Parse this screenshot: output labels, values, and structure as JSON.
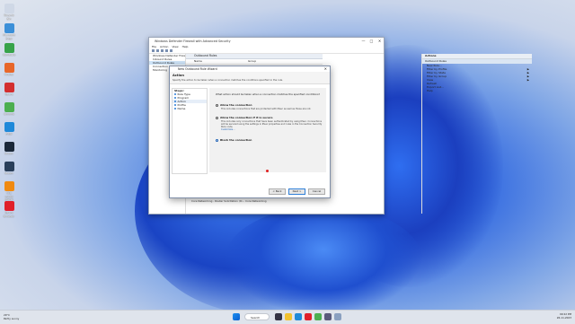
{
  "desktop": {
    "icons": [
      {
        "label": "Recycle Bin",
        "color": "#cfd8e6"
      },
      {
        "label": "Microsoft Edge",
        "color": "#3b8fd8"
      },
      {
        "label": "Camtasia",
        "color": "#37a34a"
      },
      {
        "label": "Firefox",
        "color": "#e8672a"
      },
      {
        "label": "Opera",
        "color": "#d32f2f"
      },
      {
        "label": "Chrome",
        "color": "#4caf50"
      },
      {
        "label": "Edge",
        "color": "#1f89d9"
      },
      {
        "label": "Steam",
        "color": "#1b2838"
      },
      {
        "label": "Steam",
        "color": "#2a3f5a"
      },
      {
        "label": "VLC media player",
        "color": "#f08a12"
      },
      {
        "label": "Opera Browser",
        "color": "#e0202a"
      }
    ]
  },
  "main_window": {
    "title": "Windows Defender Firewall with Advanced Security",
    "controls": {
      "min": "—",
      "max": "□",
      "close": "✕"
    },
    "menu": [
      "File",
      "Action",
      "View",
      "Help"
    ],
    "tree": [
      "Windows Defender Firewall wit",
      "Inbound Rules",
      "Outbound Rules",
      "Connection Security Rules",
      "Monitoring"
    ],
    "center_header": "Outbound Rules",
    "columns": [
      "Name",
      "Group"
    ],
    "actions_header": "Actions",
    "actions_sub": "Outbound Rules",
    "actions_items": [
      "New Rule...",
      "Filter by Profile",
      "Filter by State",
      "Filter by Group",
      "View",
      "Refresh",
      "Export List...",
      "Help"
    ],
    "status_row": "Core Networking - Router Solicitation (IC...   Core Networking"
  },
  "wizard": {
    "title": "New Outbound Rule Wizard",
    "heading": "Action",
    "description": "Specify the action to be taken when a connection matches the conditions specified in the rule.",
    "steps_label": "Steps:",
    "steps": [
      "Rule Type",
      "Program",
      "Action",
      "Profile",
      "Name"
    ],
    "current_step": 2,
    "question": "What action should be taken when a connection matches the specified conditions?",
    "options": [
      {
        "title": "Allow the connection",
        "desc": "This includes connections that are protected with IPsec as well as those are not.",
        "selected": false
      },
      {
        "title": "Allow the connection if it is secure",
        "desc": "This includes only connections that have been authenticated by using IPsec. Connections will be secured using the settings in IPsec properties and rules in the Connection Security Rule node.",
        "selected": false,
        "link": "Customize..."
      },
      {
        "title": "Block the connection",
        "desc": "",
        "selected": true
      }
    ],
    "buttons": {
      "back": "< Back",
      "next": "Next >",
      "cancel": "Cancel"
    }
  },
  "taskbar": {
    "weather_temp": "29°C",
    "weather_desc": "Partly sunny",
    "search_label": "Search",
    "time": "09:22 PM",
    "date": "26-11-2023",
    "lang": "ENG\nIN"
  }
}
